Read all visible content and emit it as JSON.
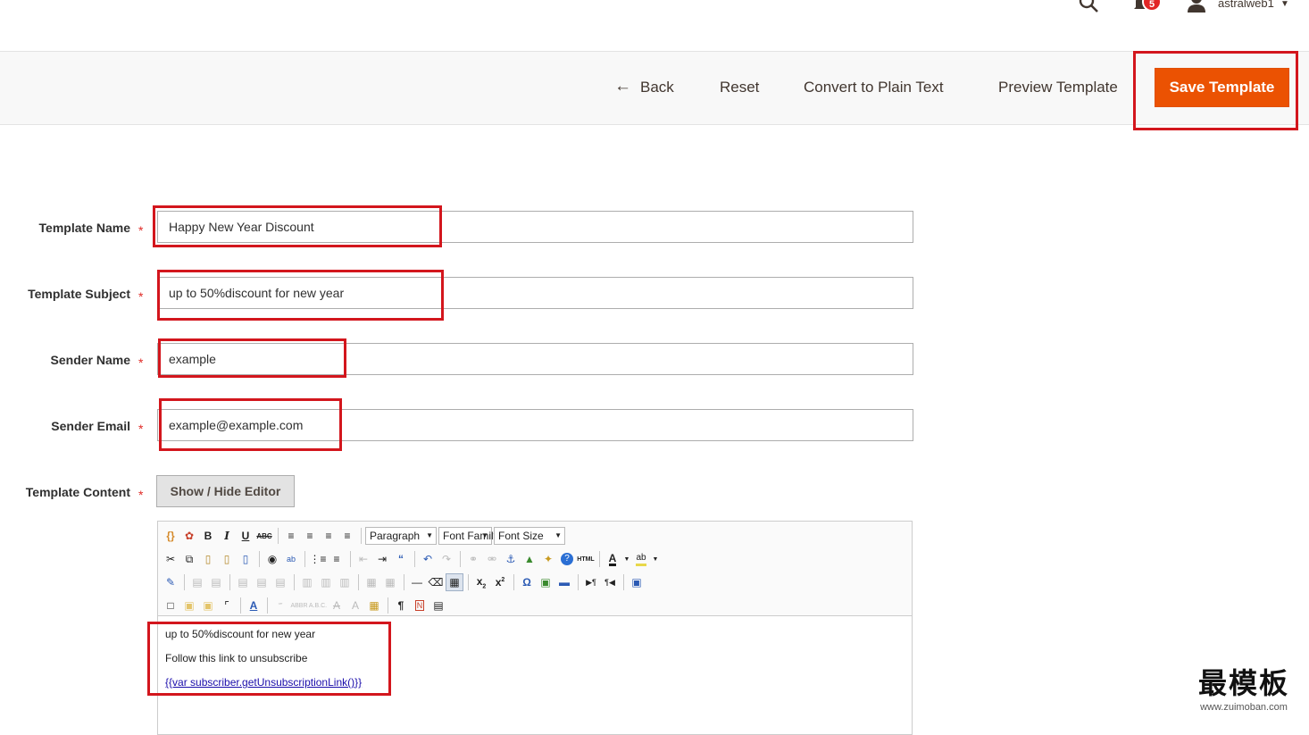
{
  "header": {
    "notifications_count": "5",
    "username": "astralweb1",
    "icons": [
      "search-icon",
      "bell-icon",
      "user-icon",
      "chevron-down-icon"
    ]
  },
  "toolbar": {
    "back_label": "Back",
    "reset_label": "Reset",
    "plain_text_label": "Convert to Plain Text",
    "preview_label": "Preview Template",
    "save_label": "Save Template",
    "save_color": "#eb5202"
  },
  "form": {
    "template_name": {
      "label": "Template Name",
      "value": "Happy New Year Discount"
    },
    "template_subject": {
      "label": "Template Subject",
      "value": "up to 50%discount for new year"
    },
    "sender_name": {
      "label": "Sender Name",
      "value": "example"
    },
    "sender_email": {
      "label": "Sender Email",
      "value": "example@example.com"
    },
    "template_content": {
      "label": "Template Content",
      "toggle_editor_label": "Show / Hide Editor"
    },
    "required_mark": "*"
  },
  "editor": {
    "format_select": "Paragraph",
    "font_family_select": "Font Family",
    "font_size_select": "Font Size",
    "content": {
      "line1": "up to 50%discount for new year",
      "line2": "Follow this link to unsubscribe",
      "line3": "{{var subscriber.getUnsubscriptionLink()}}"
    }
  },
  "highlight_color": "#d3161d",
  "watermark": {
    "text": "最模板",
    "url": "www.zuimoban.com"
  }
}
